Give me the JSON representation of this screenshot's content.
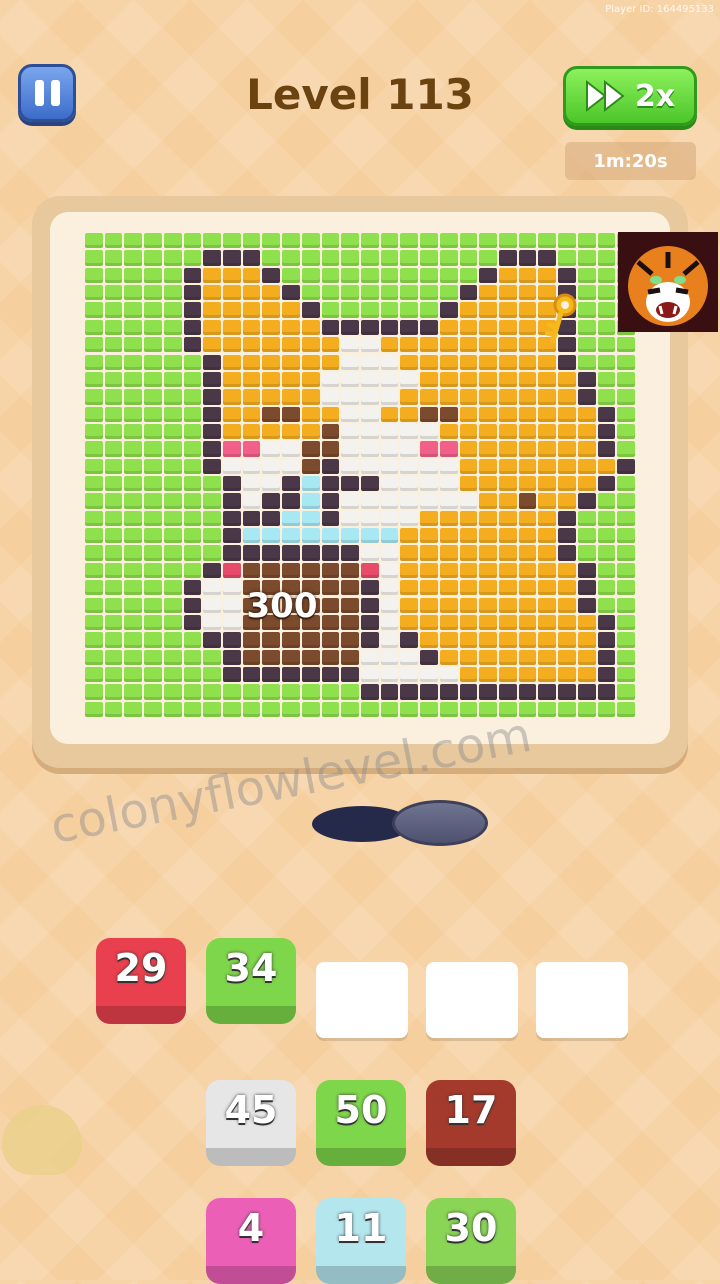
{
  "header": {
    "player_id": "Player ID: 164495133",
    "level_title": "Level 113",
    "speed_label": "2x",
    "timer": "1m:20s"
  },
  "board": {
    "cols": 28,
    "rows": 28,
    "overlay_number": "300",
    "palette": {
      "G": "#8ee04c",
      "O": "#f5ad20",
      "K": "#4a3848",
      "W": "#f4f2ee",
      "B": "#7c4a2c",
      "P": "#f2608a",
      "C": "#a8e8f2",
      "R": "#e84a6a"
    },
    "pixels": [
      "GGGGGGGGGGGGGGGGGGGGGGGGGGGG",
      "GGGGGGKKKGGGGGGGGGGGGKKKGGGG",
      "GGGGGKOOOKGGGGGGGGGGKOOOKGGG",
      "GGGGGKOOOOKGGGGGGGGKOOOOKGGG",
      "GGGGGKOOOOOKGGGGGGKOOOOOKGGG",
      "GGGGGKOOOOOOKKKKKKOOOOOOKGGG",
      "GGGGGKOOOOOOOWWOOOOOOOOOKGGG",
      "GGGGGGKOOOOOOWWWOOOOOOOOKGGG",
      "GGGGGGKOOOOOWWWWWOOOOOOOOKGG",
      "GGGGGGKOOOOOWWWWOOOOOOOOOKGG",
      "GGGGGGKOOBBOOWWOOBBOOOOOOOKG",
      "GGGGGGKOOOOOBWWWWWOOOOOOOOKG",
      "GGGGGGKPPWWBBWWWWPPOOOOOOOKG",
      "GGGGGGKWWWWBKWWWWWWOOOOOOOOK",
      "GGGGGGGKWWKCKKKWWWWOOOOOOOKG",
      "GGGGGGGKWKKCKWWWWWWWOOBOOKGG",
      "GGGGGGGKKKCCKWWWWOOOOOOOKGGG",
      "GGGGGGGKCCCCCCCCOOOOOOOOKGGG",
      "GGGGGGGKKKKKKKWWOOOOOOOOKGGG",
      "GGGGGGKRBBBBBBRWOOOOOOOOOKGG",
      "GGGGGKWWBBBBBBKWOOOOOOOOOKGG",
      "GGGGGKWWBBBBBBKWOOOOOOOOOKGG",
      "GGGGGKWWBBBBBBKWOOOOOOOOOOKG",
      "GGGGGGKKBBBBBBKWKOOOOOOOOOKG",
      "GGGGGGGKBBBBBBWWWKOOOOOOOOKG",
      "GGGGGGGKKKKKKKWWWWWOOOOOOOKG",
      "GGGGGGGGGGGGGGKKKKKKKKKKKKKG",
      "GGGGGGGGGGGGGGGGGGGGGGGGGGGG"
    ]
  },
  "watermark": "colonyflowlevel.com",
  "slots": {
    "tiles": [
      {
        "value": "29",
        "color": "#e8404e"
      },
      {
        "value": "34",
        "color": "#7ed64a"
      }
    ],
    "empty_count": 3
  },
  "queue": [
    {
      "value": "45",
      "color": "#e6e6e6"
    },
    {
      "value": "50",
      "color": "#7ed64a"
    },
    {
      "value": "17",
      "color": "#a43a2c"
    },
    {
      "value": "4",
      "color": "#ec5fb7"
    },
    {
      "value": "11",
      "color": "#b4e6ee"
    },
    {
      "value": "30",
      "color": "#8ad456"
    }
  ],
  "icons": {
    "pause": "pause-icon",
    "fast_forward": "fast-forward-icon",
    "key": "key-icon",
    "avatar": "tiger-avatar"
  }
}
